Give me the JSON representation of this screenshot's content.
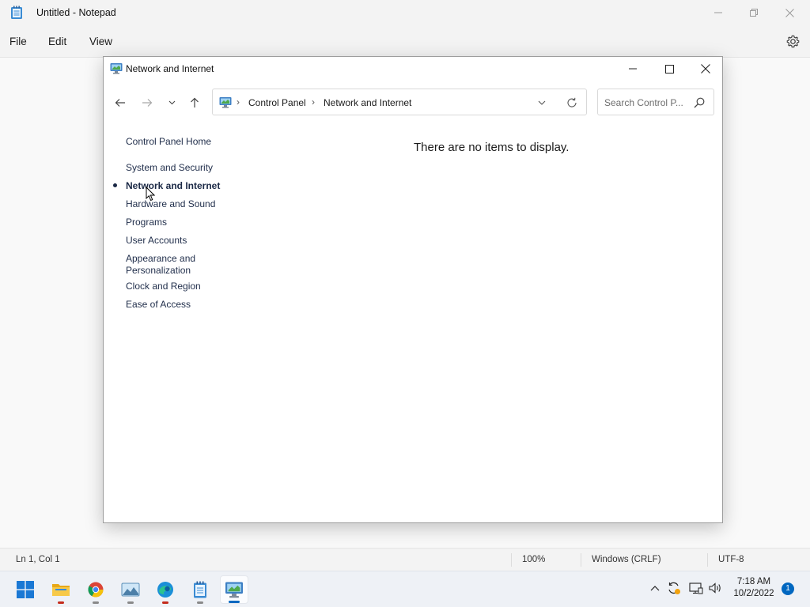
{
  "notepad": {
    "title": "Untitled - Notepad",
    "menu": [
      "File",
      "Edit",
      "View"
    ],
    "status": {
      "position": "Ln 1, Col 1",
      "zoom": "100%",
      "line_ending": "Windows (CRLF)",
      "encoding": "UTF-8"
    }
  },
  "control_panel": {
    "title": "Network and Internet",
    "breadcrumb": [
      "Control Panel",
      "Network and Internet"
    ],
    "search_placeholder": "Search Control P...",
    "sidebar": {
      "home": "Control Panel Home",
      "items": [
        {
          "label": "System and Security",
          "active": false
        },
        {
          "label": "Network and Internet",
          "active": true
        },
        {
          "label": "Hardware and Sound",
          "active": false
        },
        {
          "label": "Programs",
          "active": false
        },
        {
          "label": "User Accounts",
          "active": false
        },
        {
          "label": "Appearance and",
          "label2": "Personalization",
          "active": false
        },
        {
          "label": "Clock and Region",
          "active": false
        },
        {
          "label": "Ease of Access",
          "active": false
        }
      ]
    },
    "empty_message": "There are no items to display."
  },
  "taskbar": {
    "apps": [
      "start-icon",
      "file-explorer-icon",
      "chrome-icon",
      "photos-icon",
      "edge-icon",
      "notepad-icon",
      "control-panel-icon"
    ],
    "clock": {
      "time": "7:18 AM",
      "date": "10/2/2022"
    },
    "notification_count": "1"
  },
  "colors": {
    "accent": "#0067c0",
    "link": "#1f2d4a",
    "indicator_red": "#c42b1c"
  }
}
